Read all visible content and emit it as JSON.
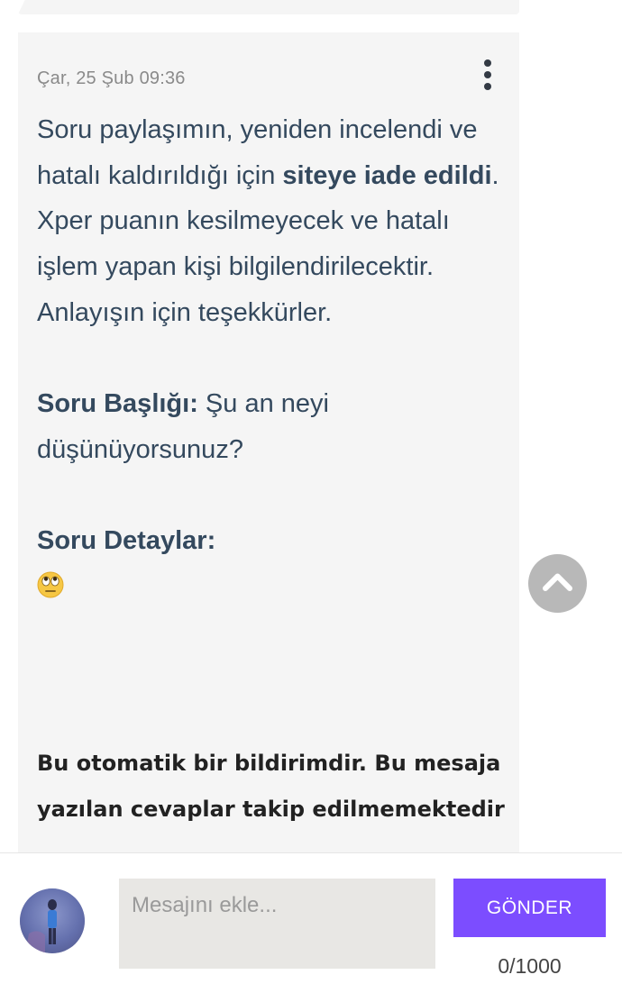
{
  "message": {
    "timestamp": "Çar, 25 Şub 09:36",
    "p1_part1": "Soru paylaşımın, yeniden incelendi ve hatalı kaldırıldığı için ",
    "p1_bold": "siteye iade edildi",
    "p1_part2": ". Xper puanın kesilmeyecek ve hatalı işlem yapan kişi bilgilendirilecektir. Anlayışın için teşekkürler.",
    "title_label": "Soru Başlığı:",
    "title_value": " Şu an neyi düşünüyorsunuz?",
    "details_label": "Soru Detaylar:",
    "details_emoji": "face-with-rolling-eyes",
    "footer_note": "Bu otomatik bir bildirimdir. Bu mesaja yazılan cevaplar takip edilmemektedir"
  },
  "composer": {
    "placeholder": "Mesajını ekle...",
    "send_label": "GÖNDER",
    "counter": "0/1000"
  },
  "icons": {
    "menu": "more-vertical-icon",
    "scroll_top": "chevron-up-icon"
  },
  "colors": {
    "accent": "#7c4dff",
    "text": "#34495e",
    "bubble": "#f5f5f5",
    "input_bg": "#e8e7e4"
  }
}
